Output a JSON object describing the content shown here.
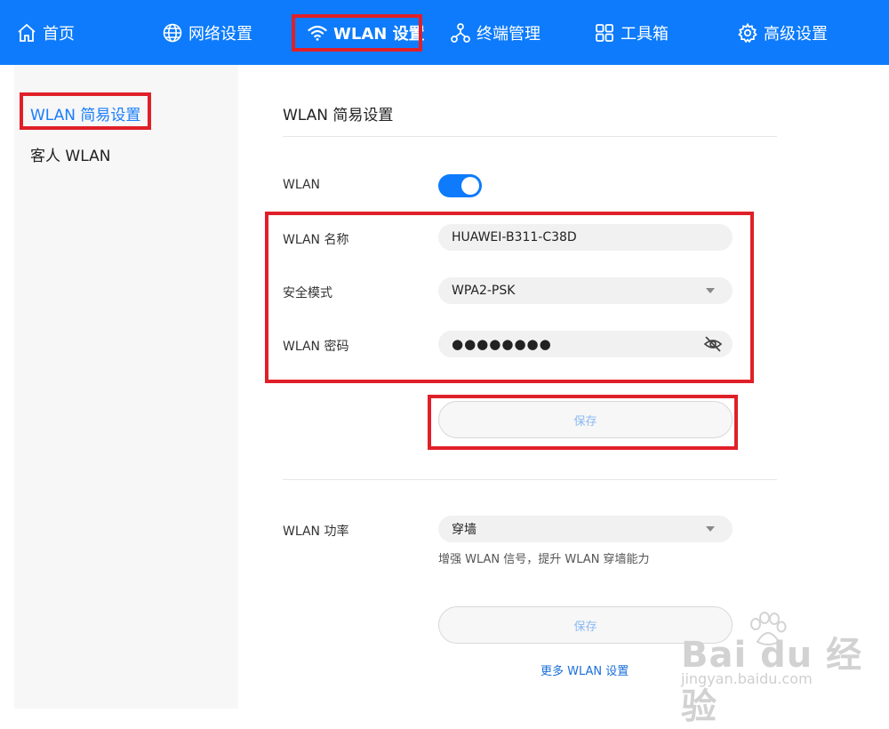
{
  "nav": {
    "items": [
      {
        "label": "首页",
        "icon": "home-icon"
      },
      {
        "label": "网络设置",
        "icon": "globe-icon"
      },
      {
        "label": "WLAN 设置",
        "icon": "wifi-icon",
        "active": true
      },
      {
        "label": "终端管理",
        "icon": "devices-icon"
      },
      {
        "label": "工具箱",
        "icon": "grid-icon"
      },
      {
        "label": "高级设置",
        "icon": "gear-icon"
      }
    ]
  },
  "sidebar": {
    "items": [
      {
        "label": "WLAN 简易设置",
        "active": true
      },
      {
        "label": "客人 WLAN"
      }
    ]
  },
  "main": {
    "title": "WLAN 简易设置",
    "wlan_label": "WLAN",
    "wlan_enabled": true,
    "ssid_label": "WLAN 名称",
    "ssid_value": "HUAWEI-B311-C38D",
    "security_label": "安全模式",
    "security_value": "WPA2-PSK",
    "password_label": "WLAN 密码",
    "password_value": "●●●●●●●●",
    "save_label": "保存",
    "power_label": "WLAN 功率",
    "power_value": "穿墙",
    "power_hint": "增强 WLAN 信号，提升 WLAN 穿墙能力",
    "save2_label": "保存",
    "more_link": "更多 WLAN 设置"
  },
  "watermark": {
    "brand": "Bai du 经验",
    "url": "jingyan.baidu.com"
  },
  "colors": {
    "nav_bg": "#0d7bfb",
    "accent": "#1a7efb",
    "highlight": "#e02029",
    "sidebar_bg": "#f7f7f7"
  }
}
